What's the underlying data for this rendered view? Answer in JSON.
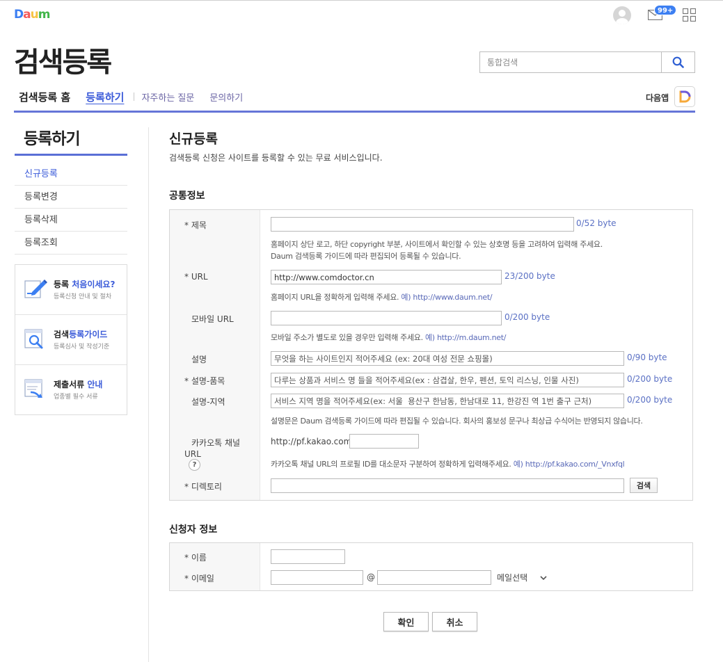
{
  "header": {
    "logo": [
      "D",
      "a",
      "u",
      "m"
    ],
    "mail_badge": "99+",
    "page_title": "검색등록",
    "search": {
      "placeholder": "통합검색"
    },
    "tabs": [
      {
        "label": "검색등록 홈"
      },
      {
        "label": "등록하기"
      },
      {
        "label": "자주하는 질문"
      },
      {
        "label": "문의하기"
      }
    ],
    "daum_app_label": "다음앱"
  },
  "colors": {
    "accent": "#3b5bd9",
    "header_line": "#6575d8",
    "logo": [
      "#3c7ff2",
      "#f65a5a",
      "#f6c343",
      "#42b54a"
    ]
  },
  "sidebar": {
    "title": "등록하기",
    "items": [
      {
        "label": "신규등록"
      },
      {
        "label": "등록변경"
      },
      {
        "label": "등록삭제"
      },
      {
        "label": "등록조회"
      }
    ],
    "banners": [
      {
        "title_plain": "등록 ",
        "title_hl": "처음이세요?",
        "sub": "등록신청 안내 및 절차",
        "icon": "pencil-doc-icon"
      },
      {
        "title_plain": "검색",
        "title_hl": "등록가이드",
        "sub": "등록심사 및 작성기준",
        "icon": "magnifier-doc-icon"
      },
      {
        "title_plain": "제출서류 ",
        "title_hl": "안내",
        "sub": "업종별 필수 서류",
        "icon": "document-arrow-icon"
      }
    ]
  },
  "content": {
    "title": "신규등록",
    "desc": "검색등록 신청은 사이트를 등록할 수 있는 무료 서비스입니다.",
    "common_section": "공통정보",
    "fields": {
      "title": {
        "label": "* 제목",
        "value": "",
        "byte": "0/52 byte",
        "help1": "홈페이지 상단 로고, 하단 copyright 부분, 사이트에서 확인할 수 있는 상호명 등을 고려하여 입력해 주세요.",
        "help2": "Daum 검색등록 가이드에 따라 편집되어 등록될 수 있습니다."
      },
      "url": {
        "label": "* URL",
        "value": "http://www.comdoctor.cn",
        "byte": "23/200 byte",
        "help": "홈페이지 URL을 정확하게 입력해 주세요. ",
        "example": "예) http://www.daum.net/"
      },
      "mobile_url": {
        "label": "모바일 URL",
        "value": "",
        "byte": "0/200 byte",
        "help": "모바일 주소가 별도로 있을 경우만 입력해 주세요. ",
        "example": "예) http://m.daum.net/"
      },
      "desc": {
        "label": "설명",
        "placeholder": "무엇을 하는 사이트인지 적어주세요 (ex: 20대 여성 전문 쇼핑몰)",
        "byte": "0/90 byte"
      },
      "desc_items": {
        "label": "* 설명-품목",
        "placeholder": "다루는 상품과 서비스 명 들을 적어주세요(ex : 삼겹살, 한우, 펜션, 토익 리스닝, 인물 사진)",
        "byte": "0/200 byte"
      },
      "desc_region": {
        "label": "설명-지역",
        "placeholder": "서비스 지역 명을 적어주세요(ex: 서울  용산구 한남동, 한남대로 11, 한강진 역 1번 출구 근처)",
        "byte": "0/200 byte"
      },
      "desc_help": "설명문은 Daum 검색등록 가이드에 따라 편집될 수 있습니다. 회사의 홍보성 문구나 최상급 수식어는 반영되지 않습니다.",
      "kakao": {
        "label_line1": "카카오톡 채널",
        "label_line2": "URL",
        "prefix": "http://pf.kakao.com/",
        "value": "",
        "help": "카카오톡 채널 URL의 프로필 ID를 대소문자 구분하여 정확하게 입력해주세요. ",
        "example": "예) http://pf.kakao.com/_Vnxfql",
        "help_icon": "?"
      },
      "directory": {
        "label": "* 디렉토리",
        "value": "",
        "button": "검색"
      }
    },
    "applicant_section": "신청자 정보",
    "applicant": {
      "name": {
        "label": "* 이름",
        "value": ""
      },
      "email": {
        "label": "* 이메일",
        "local": "",
        "at": "@",
        "domain": "",
        "select": "메일선택"
      }
    },
    "buttons": {
      "confirm": "확인",
      "cancel": "취소"
    }
  }
}
